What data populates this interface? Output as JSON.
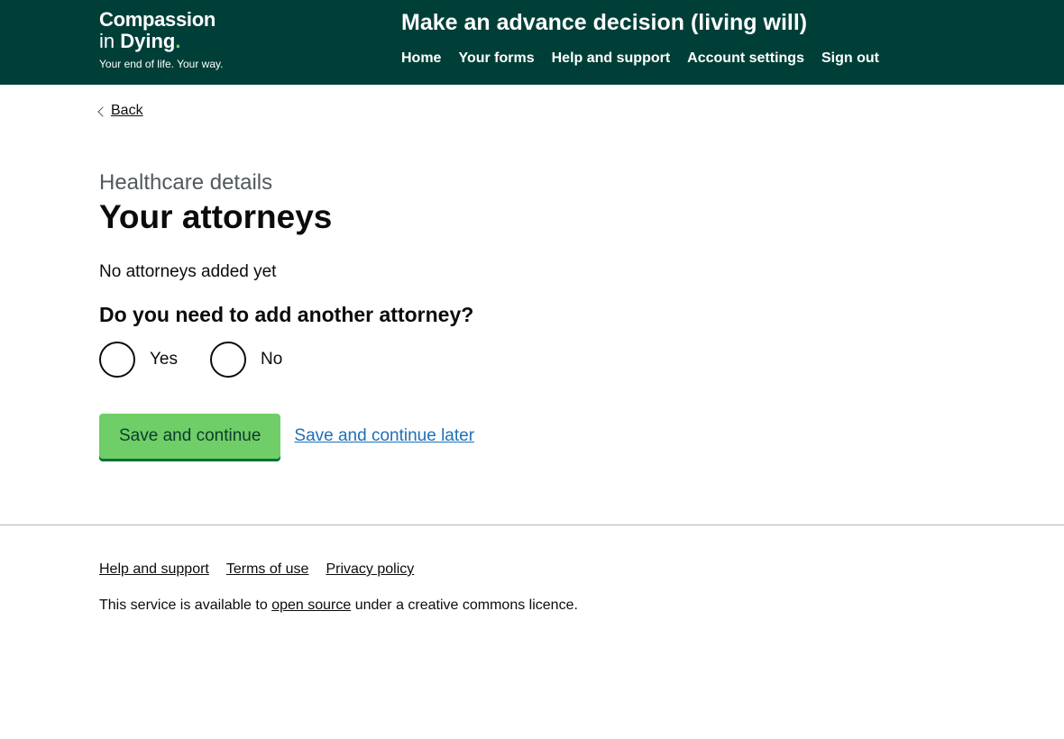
{
  "header": {
    "logo": {
      "line1": "Compassion",
      "line2_prefix": "in ",
      "line2_bold": "Dying",
      "line2_dot": ".",
      "tagline": "Your end of life. Your way."
    },
    "service_title": "Make an advance decision (living will)",
    "nav": {
      "home": "Home",
      "your_forms": "Your forms",
      "help_support": "Help and support",
      "account_settings": "Account settings",
      "sign_out": "Sign out"
    }
  },
  "main": {
    "back_label": "Back",
    "caption": "Healthcare details",
    "title": "Your attorneys",
    "empty_text": "No attorneys added yet",
    "question": "Do you need to add another attorney?",
    "options": {
      "yes": "Yes",
      "no": "No"
    },
    "save_continue": "Save and continue",
    "save_later": "Save and continue later"
  },
  "footer": {
    "links": {
      "help_support": "Help and support",
      "terms": "Terms of use",
      "privacy": "Privacy policy"
    },
    "licence_prefix": "This service is available to ",
    "licence_link": "open source",
    "licence_suffix": " under a creative commons licence."
  },
  "colors": {
    "header_bg": "#003f38",
    "brand_green": "#78d26b",
    "button_bg": "#6fce67",
    "link_blue": "#1d70b8"
  }
}
